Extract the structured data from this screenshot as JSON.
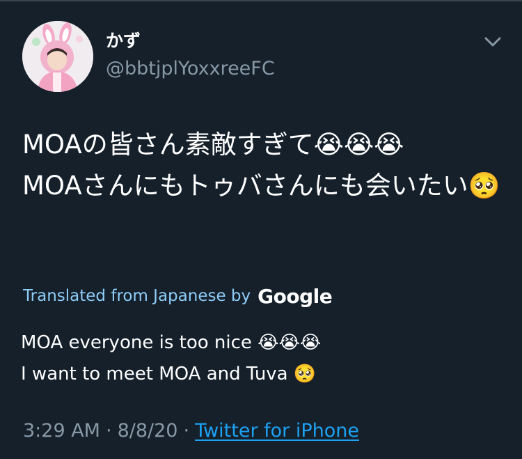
{
  "tweet": {
    "display_name": "かず",
    "handle": "@bbtjplYoxxreeFC",
    "text": "MOAの皆さん素敵すぎて😭😭😭\nMOAさんにもトゥバさんにも会いたい🥺",
    "translation_label": "Translated from Japanese by",
    "translation_provider": "Google",
    "translated_text": "MOA everyone is too nice 😭😭😭\nI want to meet MOA and Tuva 🥺",
    "time": "3:29 AM",
    "separator": "·",
    "date": "8/8/20",
    "source": "Twitter for iPhone"
  },
  "colors": {
    "background": "#15202b",
    "secondary_text": "#8899a6",
    "link": "#1da1f2",
    "translated_label": "#8ecdf8"
  },
  "icons": {
    "caret": "chevron-down-icon",
    "avatar": "avatar"
  }
}
